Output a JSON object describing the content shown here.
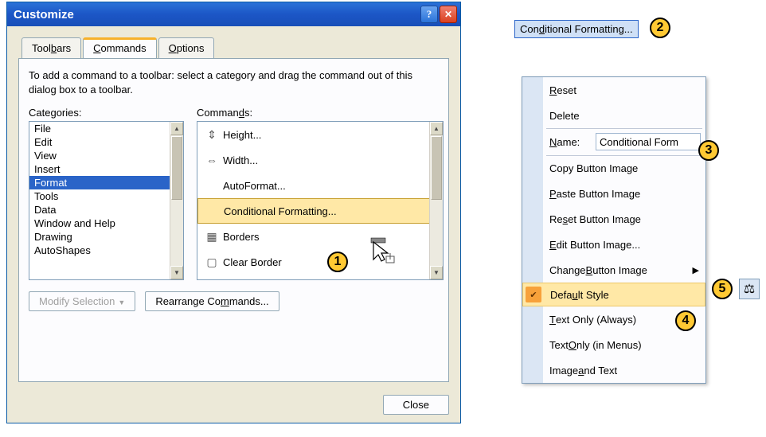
{
  "dialog": {
    "title": "Customize",
    "tabs": {
      "toolbars": "Toolbars",
      "commands": "Commands",
      "options": "Options"
    },
    "hint": "To add a command to a toolbar: select a category and drag the command out of this dialog box to a toolbar.",
    "categories_label": "Categories:",
    "commands_label": "Commands:",
    "categories": [
      "File",
      "Edit",
      "View",
      "Insert",
      "Format",
      "Tools",
      "Data",
      "Window and Help",
      "Drawing",
      "AutoShapes"
    ],
    "selected_category_index": 4,
    "commands": {
      "items": [
        {
          "label": "Height...",
          "icon": "height-icon"
        },
        {
          "label": "Width...",
          "icon": "width-icon"
        },
        {
          "label": "AutoFormat...",
          "icon": ""
        },
        {
          "label": "Conditional Formatting...",
          "icon": ""
        },
        {
          "label": "Borders",
          "icon": "borders-icon",
          "has_submenu": true
        },
        {
          "label": "Clear Border",
          "icon": "clear-border-icon"
        }
      ],
      "selected_index": 3
    },
    "modify_label": "Modify Selection",
    "rearrange_label": "Rearrange Commands...",
    "close_label": "Close"
  },
  "cf_button_label": "Conditional Formatting...",
  "context_menu": {
    "reset": "Reset",
    "delete": "Delete",
    "name_label": "Name:",
    "name_value": "Conditional Form",
    "copy_img": "Copy Button Image",
    "paste_img": "Paste Button Image",
    "reset_img": "Reset Button Image",
    "edit_img": "Edit Button Image...",
    "change_img": "Change Button Image",
    "default_style": "Default Style",
    "text_always": "Text Only (Always)",
    "text_menus": "Text Only (in Menus)",
    "image_text": "Image and Text"
  },
  "callouts": {
    "1": "1",
    "2": "2",
    "3": "3",
    "4": "4",
    "5": "5"
  },
  "scales_icon": "⚖"
}
